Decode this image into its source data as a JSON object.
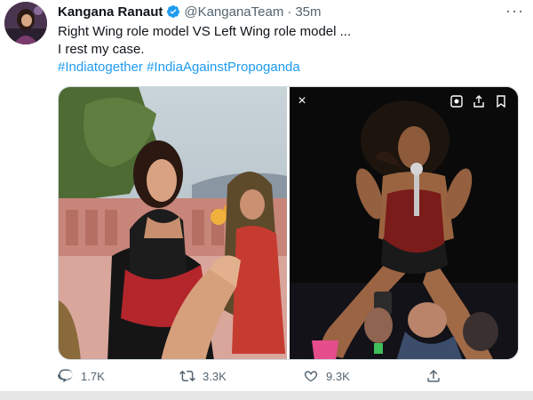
{
  "tweet": {
    "author_name": "Kangana Ranaut",
    "author_handle": "@KanganaTeam",
    "separator": "·",
    "time": "35m",
    "more": "···",
    "text_line1": "Right Wing role model VS Left Wing role model ...",
    "text_line2": "I rest my case.",
    "hashtag1": "#Indiatogether",
    "hashtag2": "#IndiaAgainstPropoganda",
    "media_close": "×"
  },
  "actions": {
    "reply_count": "1.7K",
    "retweet_count": "3.3K",
    "like_count": "9.3K"
  },
  "colors": {
    "link": "#1d9bf0",
    "muted": "#536471",
    "verified": "#1d9bf0"
  }
}
